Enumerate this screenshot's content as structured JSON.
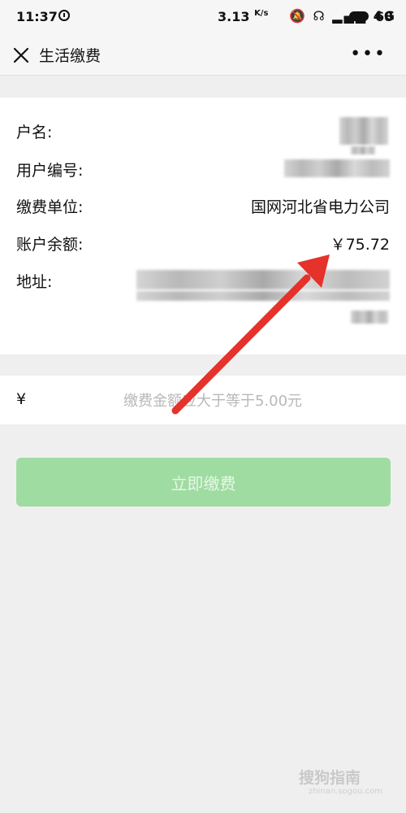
{
  "status_bar": {
    "time": "11:37",
    "speed": "3.13",
    "speed_unit": "K/s",
    "icons": "🔕 ☊ ▂▄▆ 4G",
    "battery": "68"
  },
  "nav": {
    "close_icon": "close-icon",
    "title": "生活缴费",
    "more": "•••"
  },
  "info": {
    "rows": [
      {
        "label": "户名:",
        "value": ""
      },
      {
        "label": "用户编号:",
        "value": ""
      },
      {
        "label": "缴费单位:",
        "value": "国网河北省电力公司"
      },
      {
        "label": "账户余额:",
        "value": "￥75.72"
      },
      {
        "label": "地址:",
        "value": ""
      }
    ]
  },
  "amount": {
    "currency": "¥",
    "placeholder": "缴费金额应大于等于5.00元"
  },
  "pay_button": {
    "label": "立即缴费"
  },
  "watermark": {
    "text": "搜狗指南",
    "sub": "zhinan.sogou.com"
  },
  "colors": {
    "button_bg": "#9fdca1",
    "arrow": "#e5322b",
    "page_bg": "#efeff0"
  }
}
